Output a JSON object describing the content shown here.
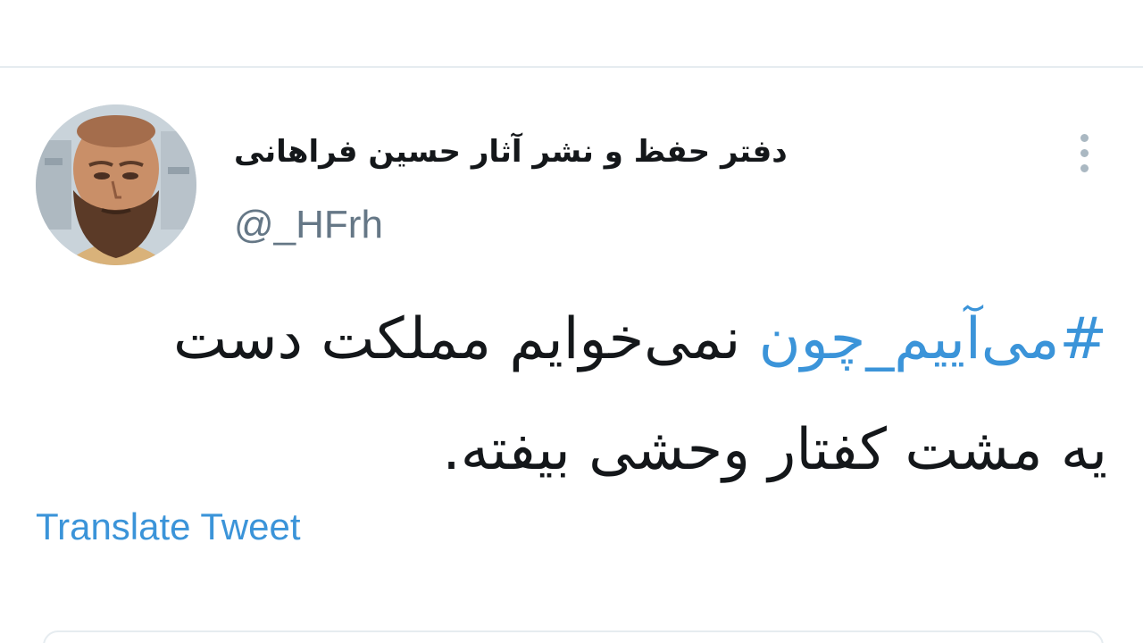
{
  "tweet": {
    "author": {
      "display_name": "دفتر حفظ و نشر آثار حسین فراهانی",
      "handle": "@_HFrh",
      "avatar_icon": "bearded-man-portrait"
    },
    "menu_icon": "vertical-dots-icon",
    "hashtag": "#می‌آییم_چون",
    "text_line1_rest": "نمی‌خوایم مملکت دست",
    "text_line2": "یه مشت کفتار وحشی بیفته.",
    "translate_label": "Translate Tweet"
  },
  "colors": {
    "link": "#3b94d9",
    "text": "#14171a",
    "secondary": "#657786",
    "divider": "#e6ecf0"
  }
}
